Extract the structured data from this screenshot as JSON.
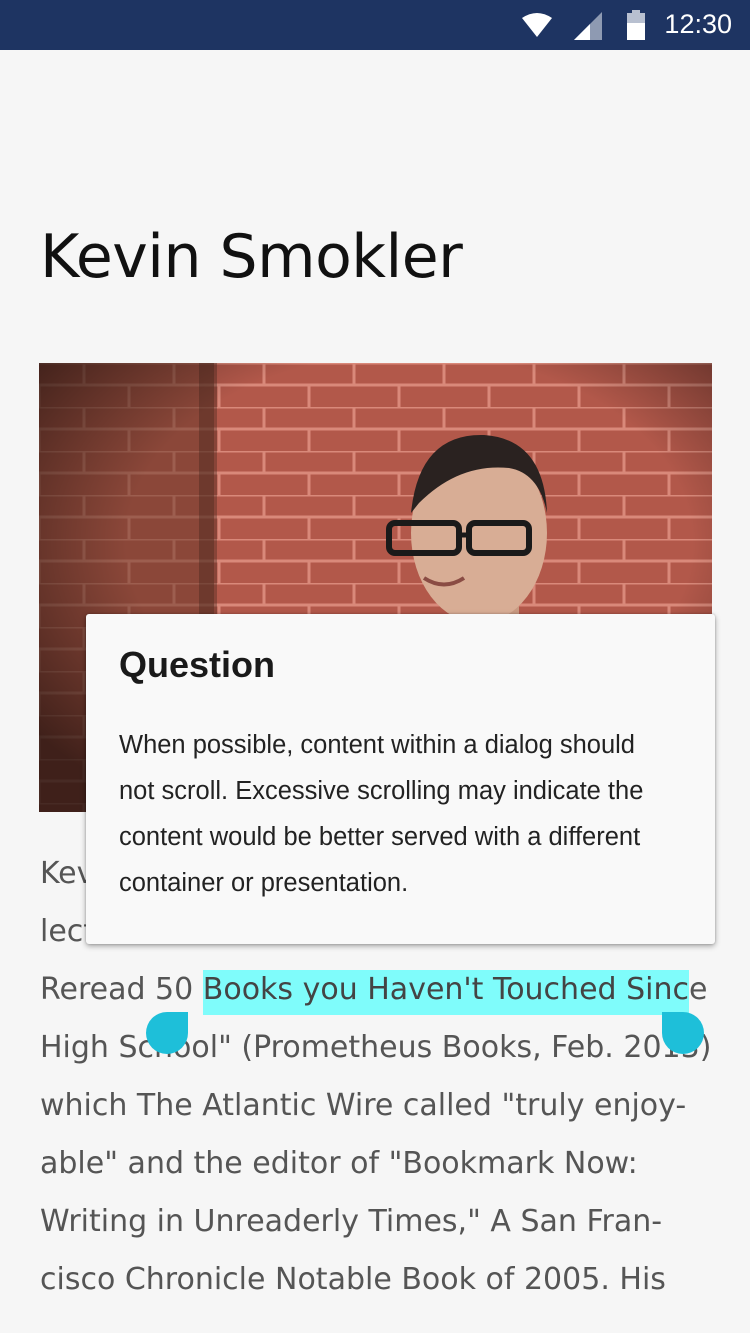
{
  "status_bar": {
    "time": "12:30",
    "icons": [
      "wifi-icon",
      "cellular-signal-icon",
      "battery-icon"
    ],
    "background_color": "#1e3462"
  },
  "page": {
    "title": "Kevin Smokler",
    "photo": "portrait-photo"
  },
  "article": {
    "lines": [
      "Kev",
      "lect",
      "Reread 50 ",
      "High School\" (Prometheus Books, Feb. 2013)",
      "which The Atlantic Wire called \"truly enjoy-",
      "able\" and the editor of \"Bookmark Now:",
      "Writing in Unreaderly Times,\" A San Fran-",
      "cisco Chronicle Notable Book of 2005. His"
    ],
    "highlighted_text": "Books you Haven't Touched Sinc",
    "after_highlight": "e",
    "highlight_color": "#7ffcfb",
    "handle_color": "#1ebfd9"
  },
  "dialog": {
    "title": "Question",
    "body_lines": [
      "When possible, content within a dialog should",
      "not scroll. Excessive scrolling may indicate the",
      "content would be better served with a different",
      "container or presentation."
    ]
  }
}
